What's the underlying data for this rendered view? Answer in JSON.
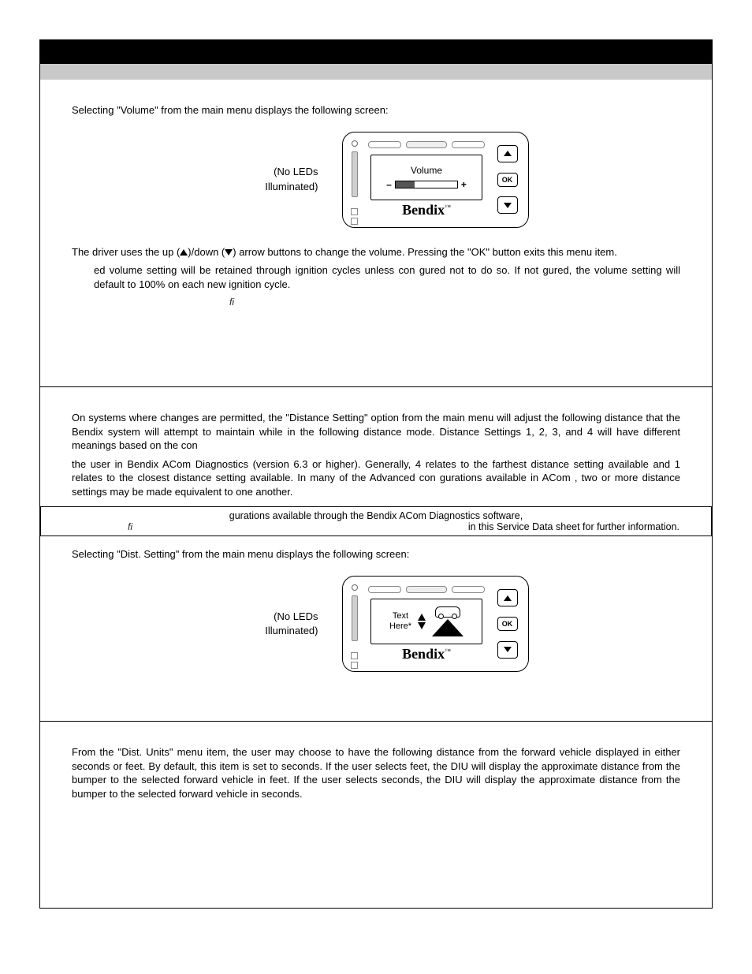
{
  "section_volume": {
    "intro": "Selecting \"Volume\" from the main menu displays the following screen:",
    "led_note_l1": "(No LEDs",
    "led_note_l2": "Illuminated)",
    "screen_label": "Volume",
    "minus": "–",
    "plus": "+",
    "brand": "Bendix",
    "ok": "OK",
    "para2_a": "The driver uses the up (",
    "para2_b": ")/down (",
    "para2_c": ") arrow buttons to change the volume.  Pressing the \"OK\" button exits this menu item.",
    "para3": "ed volume setting will be retained through ignition cycles unless con   gured not to do so.  If not gured, the volume setting will default to 100% on each new ignition cycle.",
    "fi": "fi"
  },
  "section_distance": {
    "para1": "On systems where changes are permitted, the \"Distance Setting\" option from the main menu will adjust the following distance that the Bendix                                          system will attempt to maintain while in the following distance mode.  Distance Settings 1, 2, 3, and 4 will have different meanings based on the con",
    "para1b": "the user in Bendix  ACom  Diagnostics (version 6.3 or higher).  Generally, 4 relates to the farthest distance setting available and 1 relates to the closest distance setting available.  In many of the Advanced con   gurations available in ACom  , two or more distance settings may be made equivalent to one another.",
    "note_l1": "gurations available through the Bendix ACom Diagnostics software,",
    "note_fi": "fi",
    "note_l2": "in this Service Data sheet for further information.",
    "intro2": "Selecting \"Dist. Setting\" from the main menu displays the following screen:",
    "led_note_l1": "(No LEDs",
    "led_note_l2": "Illuminated)",
    "screen_text_l1": "Text",
    "screen_text_l2": "Here*",
    "brand": "Bendix",
    "ok": "OK"
  },
  "section_units": {
    "para": "From the \"Dist. Units\" menu item, the user may choose to have the following distance from the forward vehicle displayed in either seconds or feet.  By default, this item is set to seconds.  If the user selects feet, the DIU will display the approximate distance from the bumper to the selected forward vehicle in feet.  If the user selects seconds, the DIU will display the approximate distance from the bumper to the selected forward vehicle in seconds."
  }
}
